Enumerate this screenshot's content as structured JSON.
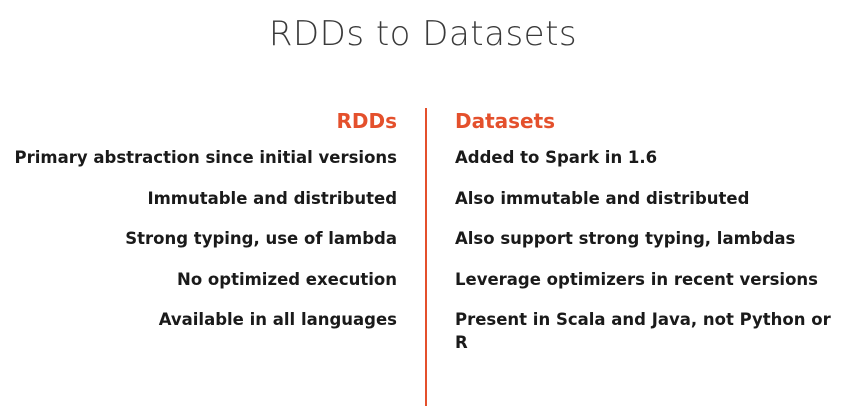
{
  "slide": {
    "title": "RDDs to Datasets"
  },
  "left": {
    "heading": "RDDs",
    "items": [
      "Primary abstraction since initial versions",
      "Immutable and distributed",
      "Strong typing, use of lambda",
      "No optimized execution",
      "Available in all languages"
    ]
  },
  "right": {
    "heading": "Datasets",
    "items": [
      "Added to Spark in 1.6",
      "Also immutable and distributed",
      "Also support strong typing, lambdas",
      "Leverage optimizers in recent versions",
      "Present in Scala and Java, not Python or R"
    ]
  },
  "colors": {
    "accent": "#e4502c",
    "text": "#1a1a1a",
    "title": "#3a3a3a"
  }
}
